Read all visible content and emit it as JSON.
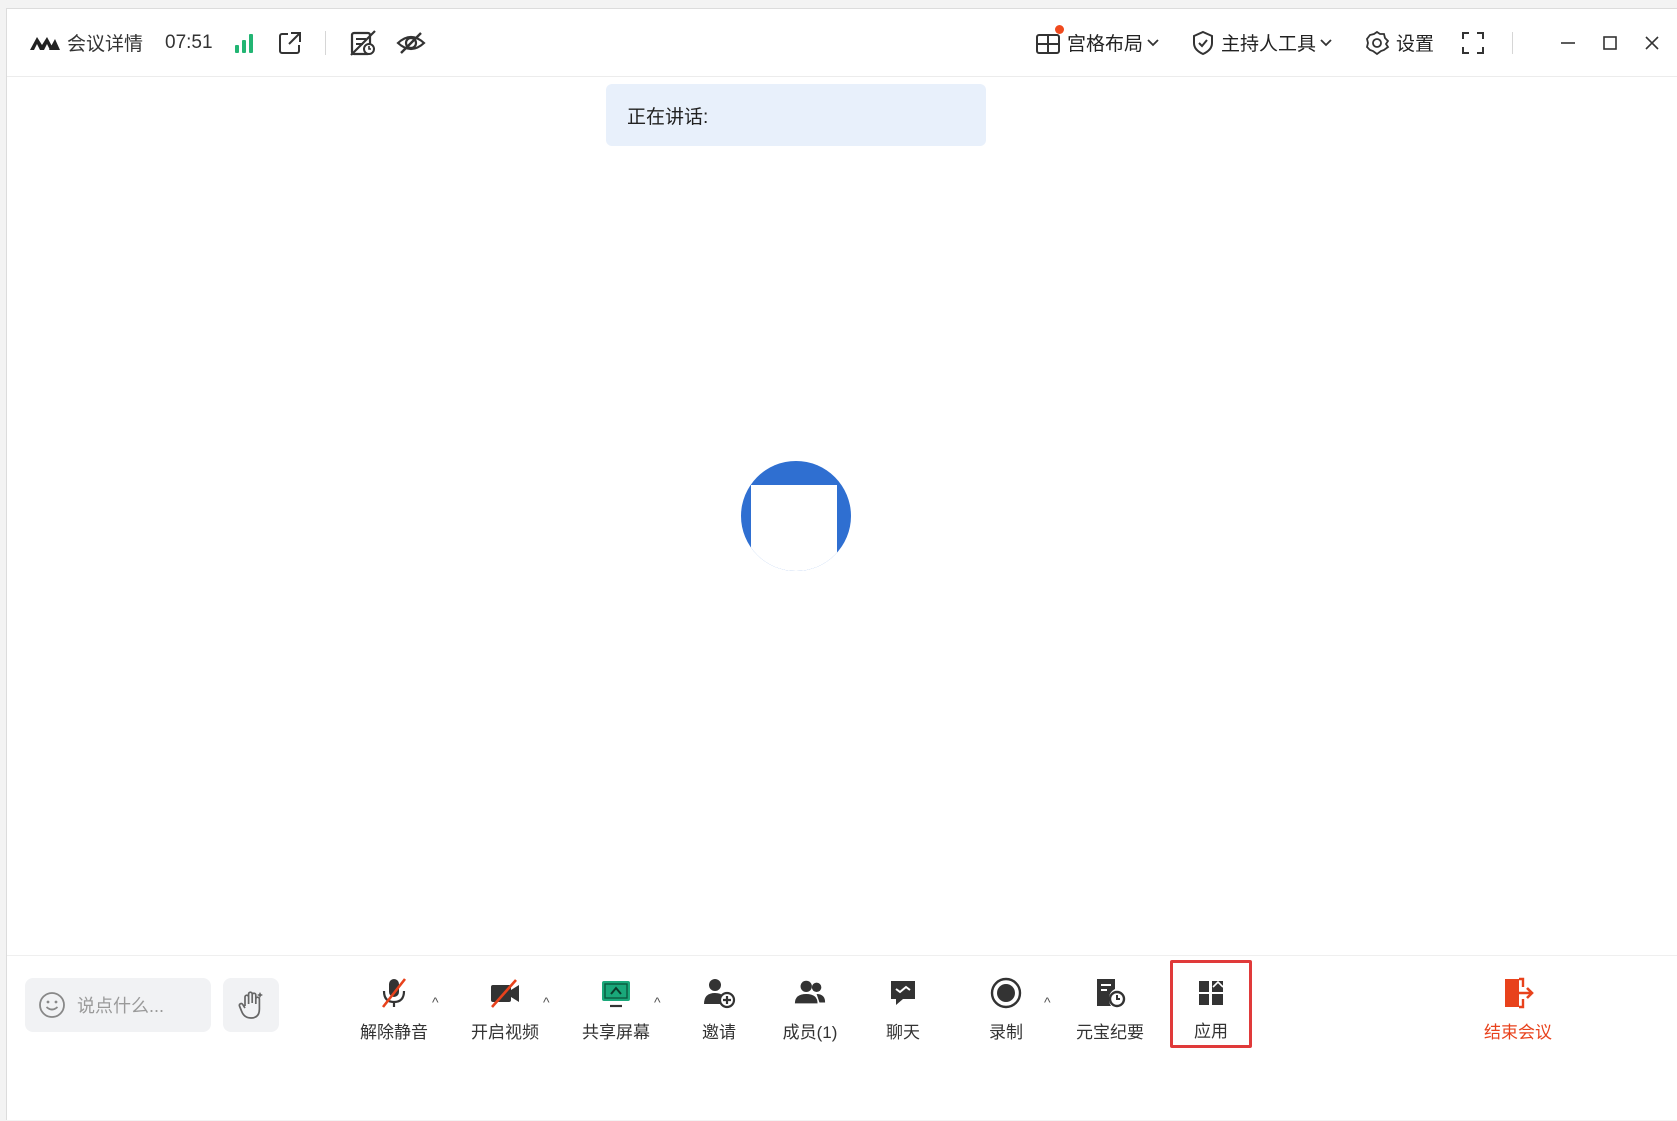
{
  "titlebar": {
    "meeting_details_label": "会议详情",
    "meeting_time": "07:51",
    "layout_label": "宫格布局",
    "host_tools_label": "主持人工具",
    "settings_label": "设置"
  },
  "speaking": {
    "label": "正在讲话:"
  },
  "toolbar": {
    "say_placeholder": "说点什么...",
    "unmute_label": "解除静音",
    "start_video_label": "开启视频",
    "share_screen_label": "共享屏幕",
    "invite_label": "邀请",
    "members_label": "成员(1)",
    "chat_label": "聊天",
    "record_label": "录制",
    "summary_label": "元宝纪要",
    "apps_label": "应用",
    "end_meeting_label": "结束会议"
  },
  "colors": {
    "accent_blue": "#2f6fd1",
    "signal_green": "#22b573",
    "share_green": "#1aa87a",
    "end_red": "#e8421c",
    "highlight_red": "#e03a3a",
    "banner_bg": "#e8f0fb"
  }
}
